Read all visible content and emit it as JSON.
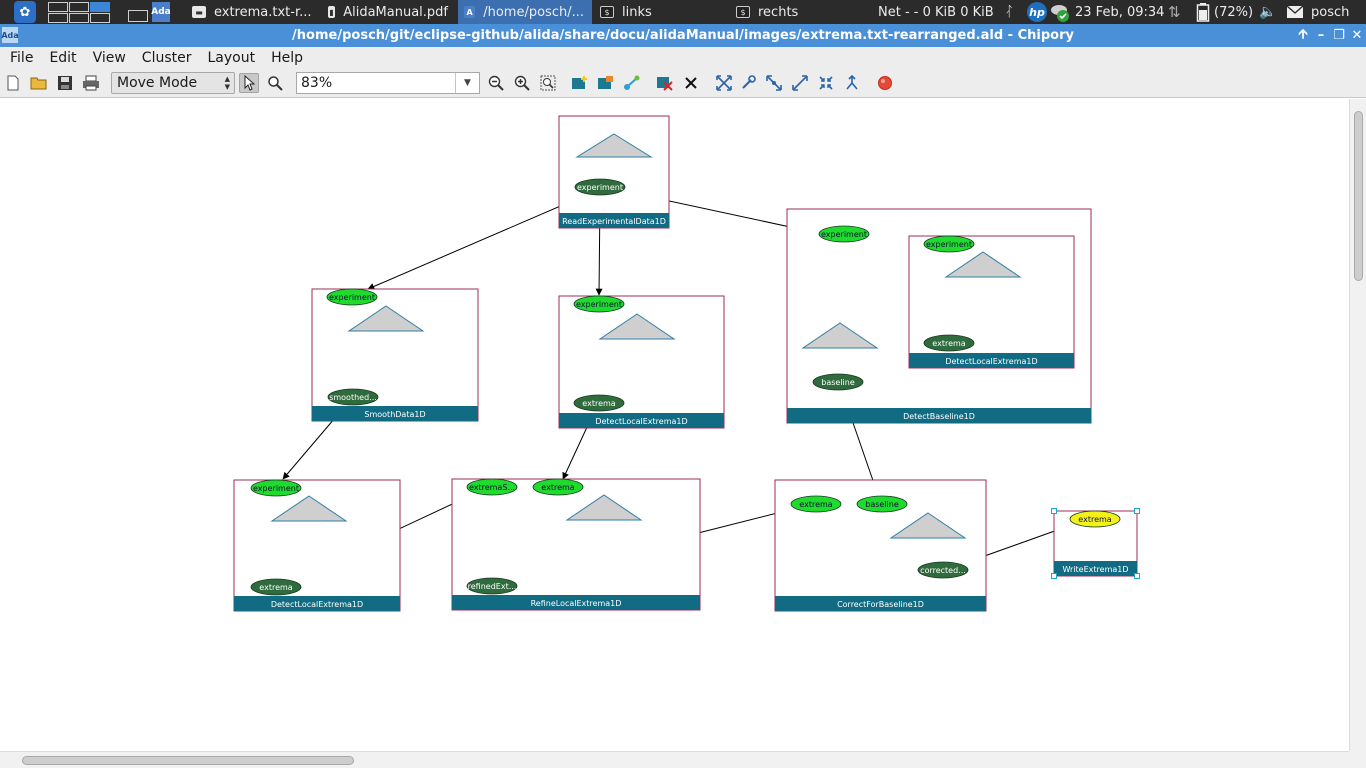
{
  "taskbar": {
    "logo_icon": "distro-logo-icon",
    "tasks": [
      {
        "label": "extrema.txt-r...",
        "icon": "document-icon"
      },
      {
        "label": "AlidaManual.pdf",
        "icon": "pdf-icon"
      },
      {
        "label": "/home/posch/...",
        "icon": "ada-app-icon",
        "active": true
      },
      {
        "label": "links",
        "icon": "terminal-icon"
      },
      {
        "label": "rechts",
        "icon": "terminal-icon"
      }
    ],
    "net": "Net - -  0 KiB 0 KiB",
    "datetime": "23 Feb, 09:34",
    "battery": "(72%)",
    "user": "posch"
  },
  "window": {
    "title": "/home/posch/git/eclipse-github/alida/share/docu/alidaManual/images/extrema.txt-rearranged.ald - Chipory",
    "app_icon_text": "Ada"
  },
  "menubar": [
    "File",
    "Edit",
    "View",
    "Cluster",
    "Layout",
    "Help"
  ],
  "toolbar": {
    "mode": "Move Mode",
    "zoom": "83%"
  },
  "graph": {
    "colors": {
      "frame": "#9b2d5a",
      "name_bar": "#116b82",
      "input_port": "#1edb2e",
      "output_port": "#2f6b3c",
      "selected_port": "#f2f21a",
      "triangle": "#cfcfcf"
    },
    "nodes": [
      {
        "id": "read",
        "name": "ReadExperimentalData1D",
        "ports": [
          "experiment"
        ]
      },
      {
        "id": "smooth",
        "name": "SmoothData1D",
        "ports": [
          "experiment",
          "smoothed..."
        ]
      },
      {
        "id": "detect_top",
        "name": "DetectLocalExtrema1D",
        "ports": [
          "experiment",
          "extrema"
        ]
      },
      {
        "id": "baseline",
        "name": "DetectBaseline1D",
        "ports": [
          "experiment",
          "baseline"
        ]
      },
      {
        "id": "baseline_inner",
        "name": "DetectLocalExtrema1D",
        "ports": [
          "experiment",
          "extrema"
        ]
      },
      {
        "id": "detect_bottom",
        "name": "DetectLocalExtrema1D",
        "ports": [
          "experiment",
          "extrema"
        ]
      },
      {
        "id": "refine",
        "name": "RefineLocalExtrema1D",
        "ports": [
          "extremaS...",
          "extrema",
          "refinedExt..."
        ]
      },
      {
        "id": "correct",
        "name": "CorrectForBaseline1D",
        "ports": [
          "extrema",
          "baseline",
          "corrected..."
        ]
      },
      {
        "id": "write",
        "name": "WriteExtrema1D",
        "ports": [
          "extrema"
        ]
      }
    ]
  }
}
